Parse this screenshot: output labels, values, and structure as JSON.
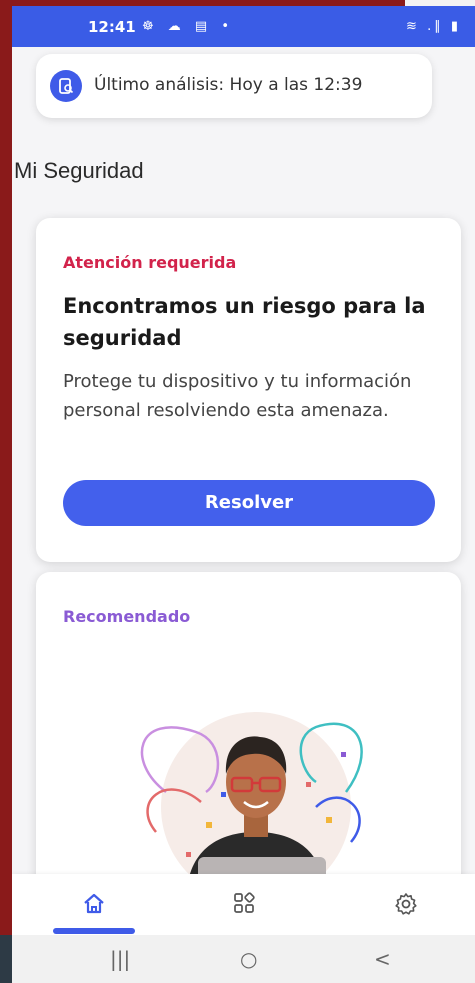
{
  "status_bar": {
    "time": "12:41",
    "left_icons": "☸ ☁ ▤ •",
    "right_icons": "≋ .∥ ▮"
  },
  "last_scan": {
    "text": "Último análisis: Hoy a las 12:39",
    "icon": "phone-scan-icon"
  },
  "section_title": "Mi Seguridad",
  "alert_card": {
    "label": "Atención requerida",
    "title": "Encontramos un riesgo para la seguridad",
    "description": "Protege tu dispositivo y tu información personal resolviendo esta amenaza.",
    "button_label": "Resolver"
  },
  "recommended_card": {
    "label": "Recomendado",
    "illustration": "person-with-laptop-illustration"
  },
  "bottom_nav": {
    "items": [
      {
        "icon": "home-icon",
        "active": true
      },
      {
        "icon": "apps-icon",
        "active": false
      },
      {
        "icon": "gear-icon",
        "active": false
      }
    ]
  },
  "system_nav": {
    "recents": "|||",
    "home": "○",
    "back": "<"
  },
  "colors": {
    "accent": "#3f5be8",
    "status_bar": "#3a5ce6",
    "alert": "#d2234b",
    "recommended": "#8a5bd4"
  }
}
